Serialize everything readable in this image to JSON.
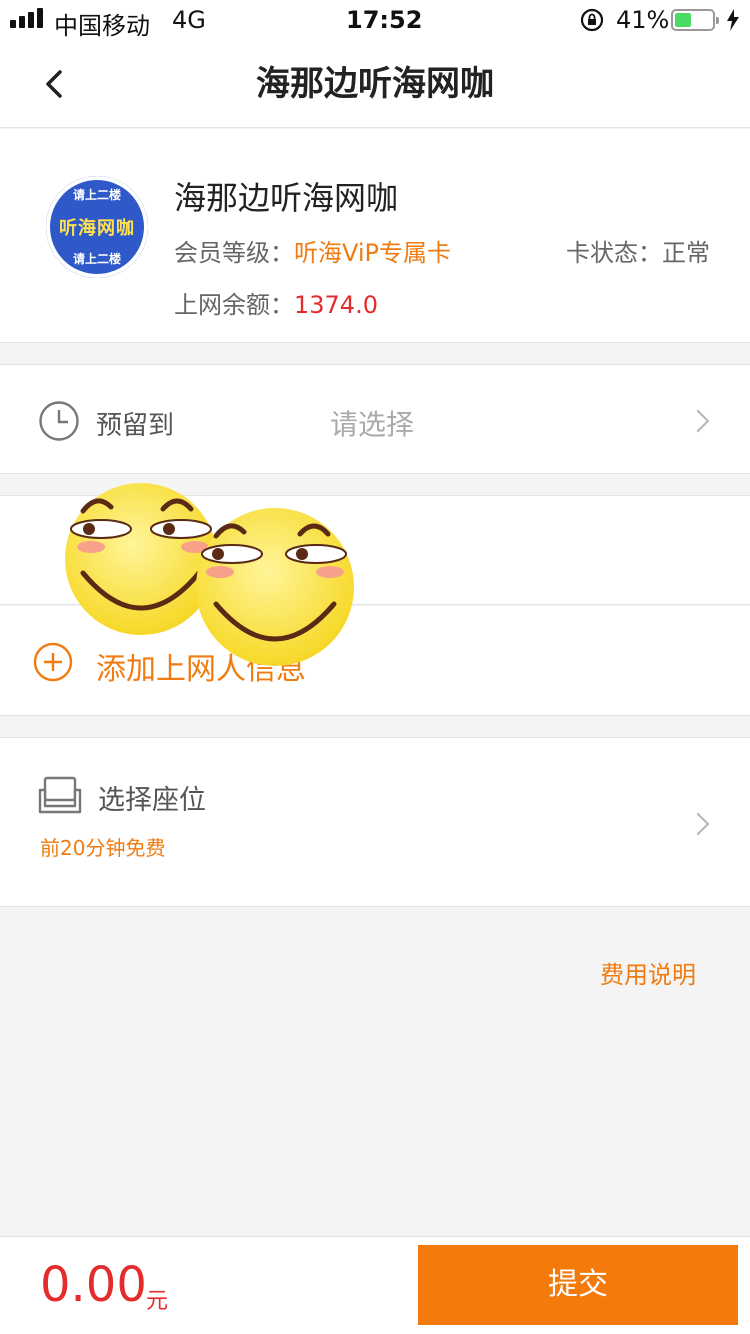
{
  "status_bar": {
    "carrier": "中国移动",
    "network": "4G",
    "time": "17:52",
    "battery_percent_text": "41%",
    "battery_level": 0.41
  },
  "nav": {
    "title": "海那边听海网咖"
  },
  "store": {
    "name": "海那边听海网咖",
    "logo_text": "听海网咖",
    "logo_arc_top": "请上二楼",
    "logo_arc_bottom": "请上二楼",
    "member_level_label": "会员等级：",
    "member_level_value": "听海ViP专属卡",
    "card_status_label": "卡状态：",
    "card_status_value": "正常",
    "balance_label": "上网余额：",
    "balance_value": "1374.0"
  },
  "reserve": {
    "label": "预留到",
    "placeholder": "请选择"
  },
  "add_person": {
    "label": "添加上网人信息"
  },
  "seat": {
    "label": "选择座位",
    "note": "前20分钟免费"
  },
  "fee_link": "费用说明",
  "footer": {
    "amount": "0.00",
    "currency": "元",
    "submit": "提交"
  },
  "colors": {
    "accent_orange": "#f57a0c",
    "price_red": "#e32d2d"
  },
  "icons": [
    "back-chevron-icon",
    "clock-icon",
    "plus-circle-icon",
    "seat-icon",
    "chevron-right-icon",
    "lock-rotation-icon",
    "charging-bolt-icon"
  ]
}
